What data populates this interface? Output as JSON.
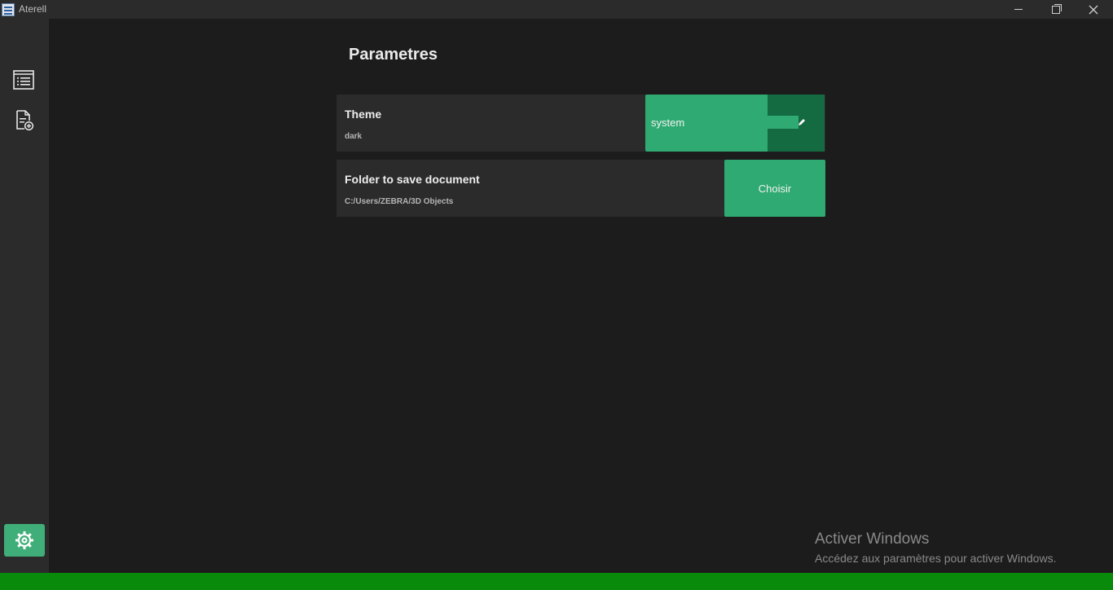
{
  "window": {
    "title": "Aterell",
    "icon": "app-logo-icon"
  },
  "sidebar": {
    "items": [
      {
        "icon": "list-icon"
      },
      {
        "icon": "new-document-icon"
      }
    ],
    "settings_icon": "gear-icon",
    "settings_color": "#3fae78"
  },
  "main": {
    "title": "Parametres",
    "theme_setting": {
      "label": "Theme",
      "value": "dark",
      "selected_option": "system",
      "edit_icon": "pencil-icon"
    },
    "folder_setting": {
      "label": "Folder to save document",
      "value": "C:/Users/ZEBRA/3D Objects",
      "button_label": "Choisir"
    }
  },
  "watermark": {
    "title": "Activer Windows",
    "subtitle": "Accédez aux paramètres pour activer Windows."
  },
  "colors": {
    "accent": "#2faa72",
    "accent_dark": "#146b42",
    "background": "#1c1c1c",
    "panel": "#2b2b2b",
    "bottom_bar": "#0a8a0a"
  }
}
